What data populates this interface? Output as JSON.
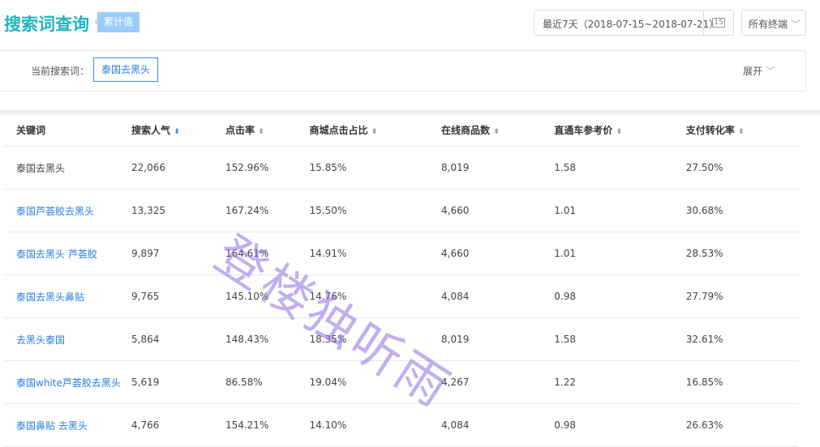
{
  "header": {
    "title": "搜索词查询",
    "badge": "累计值",
    "date_range": "最近7天（2018-07-15~2018-07-21）",
    "calendar_day": "15",
    "terminal": "所有终端"
  },
  "filter": {
    "label": "当前搜索词：",
    "keyword": "泰国去黑头",
    "expand": "展开"
  },
  "table": {
    "columns": [
      "关键词",
      "搜索人气",
      "点击率",
      "商城点击占比",
      "在线商品数",
      "直通车参考价",
      "支付转化率"
    ],
    "rows": [
      [
        "泰国去黑头",
        "22,066",
        "152.96%",
        "15.85%",
        "8,019",
        "1.58",
        "27.50%"
      ],
      [
        "泰国芦荟胶去黑头",
        "13,325",
        "167.24%",
        "15.50%",
        "4,660",
        "1.01",
        "30.68%"
      ],
      [
        "泰国去黑头 芦荟胶",
        "9,897",
        "164.61%",
        "14.91%",
        "4,660",
        "1.01",
        "28.53%"
      ],
      [
        "泰国去黑头鼻贴",
        "9,765",
        "145.10%",
        "14.76%",
        "4,084",
        "0.98",
        "27.79%"
      ],
      [
        "去黑头泰国",
        "5,864",
        "148.43%",
        "18.35%",
        "8,019",
        "1.58",
        "32.61%"
      ],
      [
        "泰国white芦荟胶去黑头",
        "5,619",
        "86.58%",
        "19.04%",
        "4,267",
        "1.22",
        "16.85%"
      ],
      [
        "泰国鼻贴 去黑头",
        "4,766",
        "154.21%",
        "14.10%",
        "4,084",
        "0.98",
        "26.63%"
      ]
    ]
  },
  "watermark": "登楼独听雨"
}
